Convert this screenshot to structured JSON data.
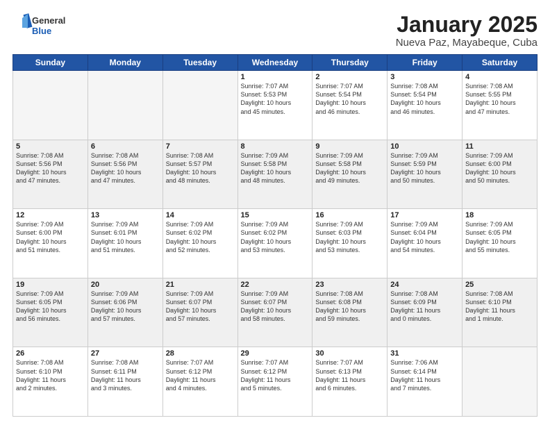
{
  "header": {
    "logo_general": "General",
    "logo_blue": "Blue",
    "title": "January 2025",
    "subtitle": "Nueva Paz, Mayabeque, Cuba"
  },
  "days_of_week": [
    "Sunday",
    "Monday",
    "Tuesday",
    "Wednesday",
    "Thursday",
    "Friday",
    "Saturday"
  ],
  "weeks": [
    [
      {
        "day": "",
        "info": "",
        "empty": true
      },
      {
        "day": "",
        "info": "",
        "empty": true
      },
      {
        "day": "",
        "info": "",
        "empty": true
      },
      {
        "day": "1",
        "info": "Sunrise: 7:07 AM\nSunset: 5:53 PM\nDaylight: 10 hours\nand 45 minutes.",
        "empty": false
      },
      {
        "day": "2",
        "info": "Sunrise: 7:07 AM\nSunset: 5:54 PM\nDaylight: 10 hours\nand 46 minutes.",
        "empty": false
      },
      {
        "day": "3",
        "info": "Sunrise: 7:08 AM\nSunset: 5:54 PM\nDaylight: 10 hours\nand 46 minutes.",
        "empty": false
      },
      {
        "day": "4",
        "info": "Sunrise: 7:08 AM\nSunset: 5:55 PM\nDaylight: 10 hours\nand 47 minutes.",
        "empty": false
      }
    ],
    [
      {
        "day": "5",
        "info": "Sunrise: 7:08 AM\nSunset: 5:56 PM\nDaylight: 10 hours\nand 47 minutes.",
        "empty": false
      },
      {
        "day": "6",
        "info": "Sunrise: 7:08 AM\nSunset: 5:56 PM\nDaylight: 10 hours\nand 47 minutes.",
        "empty": false
      },
      {
        "day": "7",
        "info": "Sunrise: 7:08 AM\nSunset: 5:57 PM\nDaylight: 10 hours\nand 48 minutes.",
        "empty": false
      },
      {
        "day": "8",
        "info": "Sunrise: 7:09 AM\nSunset: 5:58 PM\nDaylight: 10 hours\nand 48 minutes.",
        "empty": false
      },
      {
        "day": "9",
        "info": "Sunrise: 7:09 AM\nSunset: 5:58 PM\nDaylight: 10 hours\nand 49 minutes.",
        "empty": false
      },
      {
        "day": "10",
        "info": "Sunrise: 7:09 AM\nSunset: 5:59 PM\nDaylight: 10 hours\nand 50 minutes.",
        "empty": false
      },
      {
        "day": "11",
        "info": "Sunrise: 7:09 AM\nSunset: 6:00 PM\nDaylight: 10 hours\nand 50 minutes.",
        "empty": false
      }
    ],
    [
      {
        "day": "12",
        "info": "Sunrise: 7:09 AM\nSunset: 6:00 PM\nDaylight: 10 hours\nand 51 minutes.",
        "empty": false
      },
      {
        "day": "13",
        "info": "Sunrise: 7:09 AM\nSunset: 6:01 PM\nDaylight: 10 hours\nand 51 minutes.",
        "empty": false
      },
      {
        "day": "14",
        "info": "Sunrise: 7:09 AM\nSunset: 6:02 PM\nDaylight: 10 hours\nand 52 minutes.",
        "empty": false
      },
      {
        "day": "15",
        "info": "Sunrise: 7:09 AM\nSunset: 6:02 PM\nDaylight: 10 hours\nand 53 minutes.",
        "empty": false
      },
      {
        "day": "16",
        "info": "Sunrise: 7:09 AM\nSunset: 6:03 PM\nDaylight: 10 hours\nand 53 minutes.",
        "empty": false
      },
      {
        "day": "17",
        "info": "Sunrise: 7:09 AM\nSunset: 6:04 PM\nDaylight: 10 hours\nand 54 minutes.",
        "empty": false
      },
      {
        "day": "18",
        "info": "Sunrise: 7:09 AM\nSunset: 6:05 PM\nDaylight: 10 hours\nand 55 minutes.",
        "empty": false
      }
    ],
    [
      {
        "day": "19",
        "info": "Sunrise: 7:09 AM\nSunset: 6:05 PM\nDaylight: 10 hours\nand 56 minutes.",
        "empty": false
      },
      {
        "day": "20",
        "info": "Sunrise: 7:09 AM\nSunset: 6:06 PM\nDaylight: 10 hours\nand 57 minutes.",
        "empty": false
      },
      {
        "day": "21",
        "info": "Sunrise: 7:09 AM\nSunset: 6:07 PM\nDaylight: 10 hours\nand 57 minutes.",
        "empty": false
      },
      {
        "day": "22",
        "info": "Sunrise: 7:09 AM\nSunset: 6:07 PM\nDaylight: 10 hours\nand 58 minutes.",
        "empty": false
      },
      {
        "day": "23",
        "info": "Sunrise: 7:08 AM\nSunset: 6:08 PM\nDaylight: 10 hours\nand 59 minutes.",
        "empty": false
      },
      {
        "day": "24",
        "info": "Sunrise: 7:08 AM\nSunset: 6:09 PM\nDaylight: 11 hours\nand 0 minutes.",
        "empty": false
      },
      {
        "day": "25",
        "info": "Sunrise: 7:08 AM\nSunset: 6:10 PM\nDaylight: 11 hours\nand 1 minute.",
        "empty": false
      }
    ],
    [
      {
        "day": "26",
        "info": "Sunrise: 7:08 AM\nSunset: 6:10 PM\nDaylight: 11 hours\nand 2 minutes.",
        "empty": false
      },
      {
        "day": "27",
        "info": "Sunrise: 7:08 AM\nSunset: 6:11 PM\nDaylight: 11 hours\nand 3 minutes.",
        "empty": false
      },
      {
        "day": "28",
        "info": "Sunrise: 7:07 AM\nSunset: 6:12 PM\nDaylight: 11 hours\nand 4 minutes.",
        "empty": false
      },
      {
        "day": "29",
        "info": "Sunrise: 7:07 AM\nSunset: 6:12 PM\nDaylight: 11 hours\nand 5 minutes.",
        "empty": false
      },
      {
        "day": "30",
        "info": "Sunrise: 7:07 AM\nSunset: 6:13 PM\nDaylight: 11 hours\nand 6 minutes.",
        "empty": false
      },
      {
        "day": "31",
        "info": "Sunrise: 7:06 AM\nSunset: 6:14 PM\nDaylight: 11 hours\nand 7 minutes.",
        "empty": false
      },
      {
        "day": "",
        "info": "",
        "empty": true
      }
    ]
  ]
}
